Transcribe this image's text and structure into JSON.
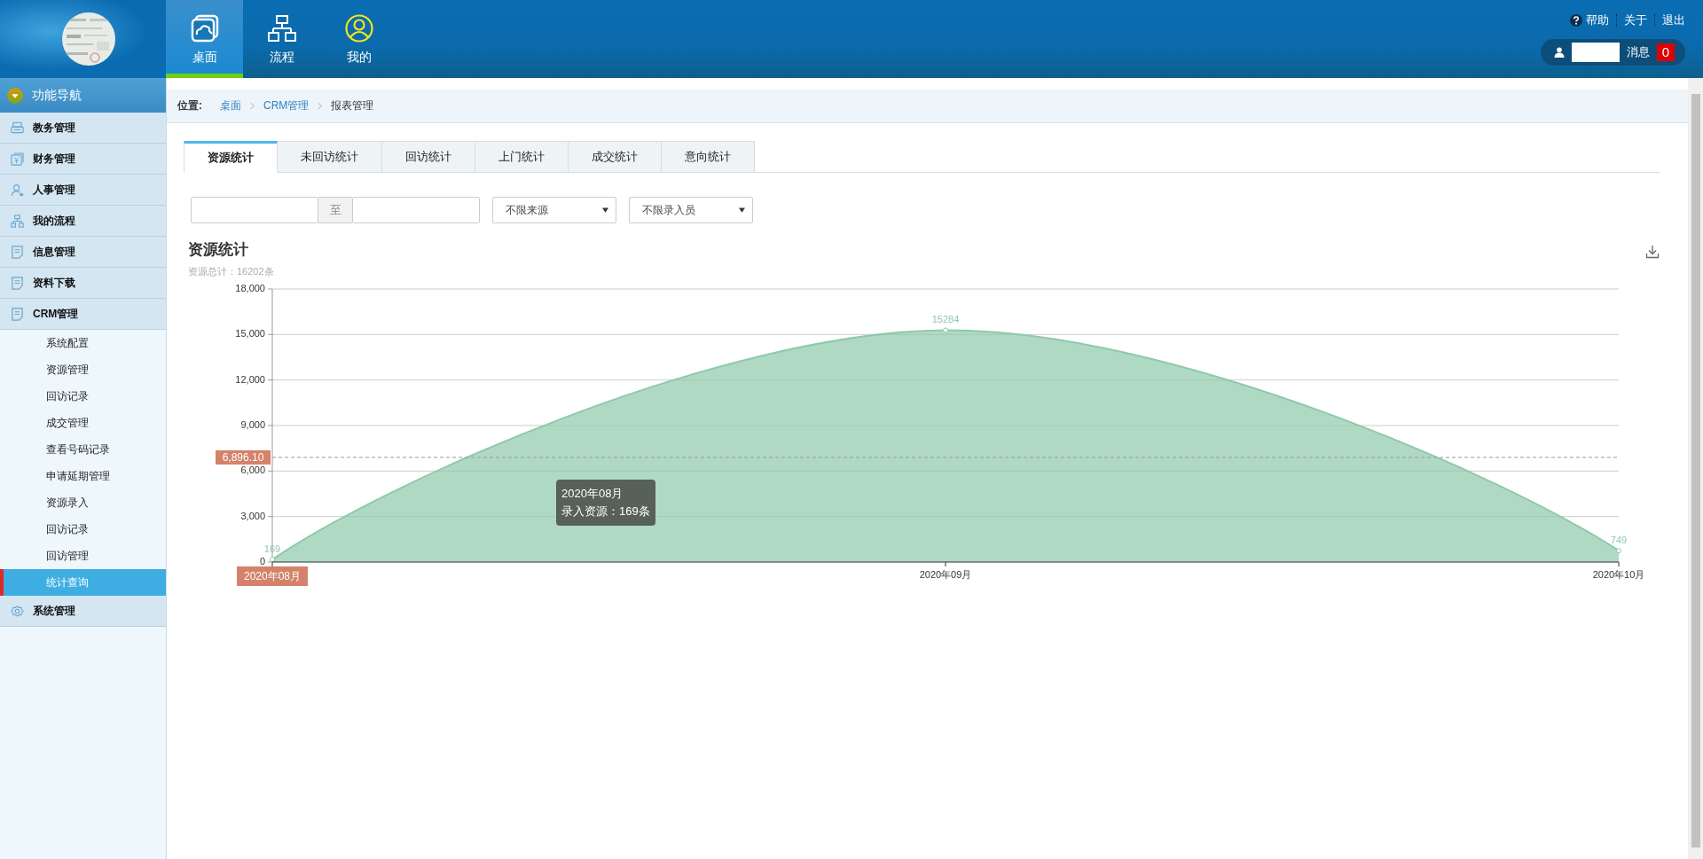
{
  "header": {
    "nav": [
      {
        "label": "桌面",
        "selected": true
      },
      {
        "label": "流程",
        "selected": false
      },
      {
        "label": "我的",
        "selected": false
      }
    ],
    "links": [
      {
        "label": "帮助",
        "kind": "help"
      },
      {
        "label": "关于",
        "kind": "plain"
      },
      {
        "label": "退出",
        "kind": "plain"
      }
    ],
    "user": {
      "messages_label": "消息",
      "message_count": "0"
    }
  },
  "sidebar": {
    "title": "功能导航",
    "items": [
      {
        "label": "教务管理"
      },
      {
        "label": "财务管理"
      },
      {
        "label": "人事管理"
      },
      {
        "label": "我的流程"
      },
      {
        "label": "信息管理"
      },
      {
        "label": "资料下载"
      },
      {
        "label": "CRM管理",
        "children": [
          {
            "label": "系统配置",
            "selected": false
          },
          {
            "label": "资源管理",
            "selected": false
          },
          {
            "label": "回访记录",
            "selected": false
          },
          {
            "label": "成交管理",
            "selected": false
          },
          {
            "label": "查看号码记录",
            "selected": false
          },
          {
            "label": "申请延期管理",
            "selected": false
          },
          {
            "label": "资源录入",
            "selected": false
          },
          {
            "label": "回访记录",
            "selected": false
          },
          {
            "label": "回访管理",
            "selected": false
          },
          {
            "label": "统计查询",
            "selected": true
          }
        ]
      },
      {
        "label": "系统管理"
      }
    ]
  },
  "breadcrumb": {
    "label": "位置:",
    "items": [
      {
        "label": "桌面",
        "kind": "link"
      },
      {
        "label": "CRM管理",
        "kind": "link"
      },
      {
        "label": "报表管理",
        "kind": "current"
      }
    ]
  },
  "tabs": [
    {
      "label": "资源统计",
      "selected": true
    },
    {
      "label": "未回访统计",
      "selected": false
    },
    {
      "label": "回访统计",
      "selected": false
    },
    {
      "label": "上门统计",
      "selected": false
    },
    {
      "label": "成交统计",
      "selected": false
    },
    {
      "label": "意向统计",
      "selected": false
    }
  ],
  "filters": {
    "date_separator": "至",
    "selects": [
      {
        "value": "不限来源"
      },
      {
        "value": "不限录入员"
      }
    ]
  },
  "report": {
    "title": "资源统计",
    "subtitle": "资源总计：16202条",
    "tooltip": {
      "title": "2020年08月",
      "line": "录入资源：169条"
    },
    "chart_data": {
      "type": "area",
      "categories": [
        "2020年08月",
        "2020年09月",
        "2020年10月"
      ],
      "series": [
        {
          "color": "#8fc9ab",
          "values": [
            169,
            15284,
            749
          ]
        }
      ],
      "ylim": [
        0,
        18000
      ],
      "yticks": [
        {
          "value": 0,
          "label": "0"
        },
        {
          "value": 3000,
          "label": "3,000"
        },
        {
          "value": 6000,
          "label": "6,000"
        },
        {
          "value": 9000,
          "label": "9,000"
        },
        {
          "value": 12000,
          "label": "12,000"
        },
        {
          "value": 15000,
          "label": "15,000"
        },
        {
          "value": 18000,
          "label": "18,000"
        }
      ],
      "grid": true,
      "data_labels": true,
      "ref_lines": [
        {
          "axis": "y",
          "value": 6896.1,
          "label": "6,896.10"
        }
      ]
    }
  }
}
